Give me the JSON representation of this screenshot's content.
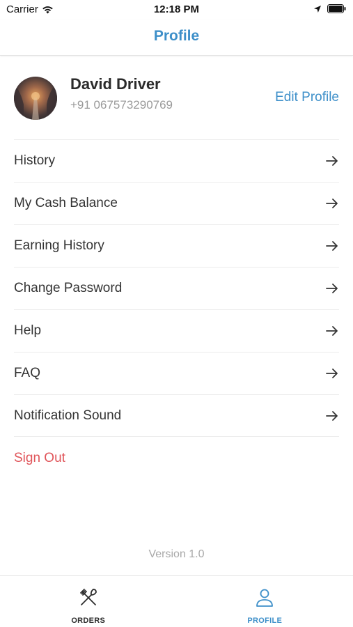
{
  "status_bar": {
    "carrier": "Carrier",
    "time": "12:18 PM",
    "icons": [
      "wifi-icon",
      "location-arrow-icon",
      "battery-icon"
    ]
  },
  "header": {
    "title": "Profile"
  },
  "profile": {
    "name": "David Driver",
    "phone": "+91 067573290769",
    "edit_label": "Edit Profile",
    "avatar_icon": "avatar-photo"
  },
  "menu": {
    "items": [
      {
        "label": "History",
        "icon": "arrow-right-icon"
      },
      {
        "label": "My Cash Balance",
        "icon": "arrow-right-icon"
      },
      {
        "label": "Earning History",
        "icon": "arrow-right-icon"
      },
      {
        "label": "Change Password",
        "icon": "arrow-right-icon"
      },
      {
        "label": "Help",
        "icon": "arrow-right-icon"
      },
      {
        "label": "FAQ",
        "icon": "arrow-right-icon"
      },
      {
        "label": "Notification Sound",
        "icon": "arrow-right-icon"
      }
    ],
    "sign_out": "Sign Out"
  },
  "footer": {
    "version": "Version 1.0"
  },
  "tab_bar": {
    "tabs": [
      {
        "label": "ORDERS",
        "icon": "fork-knife-icon",
        "active": false
      },
      {
        "label": "PROFILE",
        "icon": "user-icon",
        "active": true
      }
    ]
  },
  "colors": {
    "accent": "#3d8fc9",
    "danger": "#e0555a",
    "text": "#333333",
    "muted": "#9a9a9a"
  }
}
